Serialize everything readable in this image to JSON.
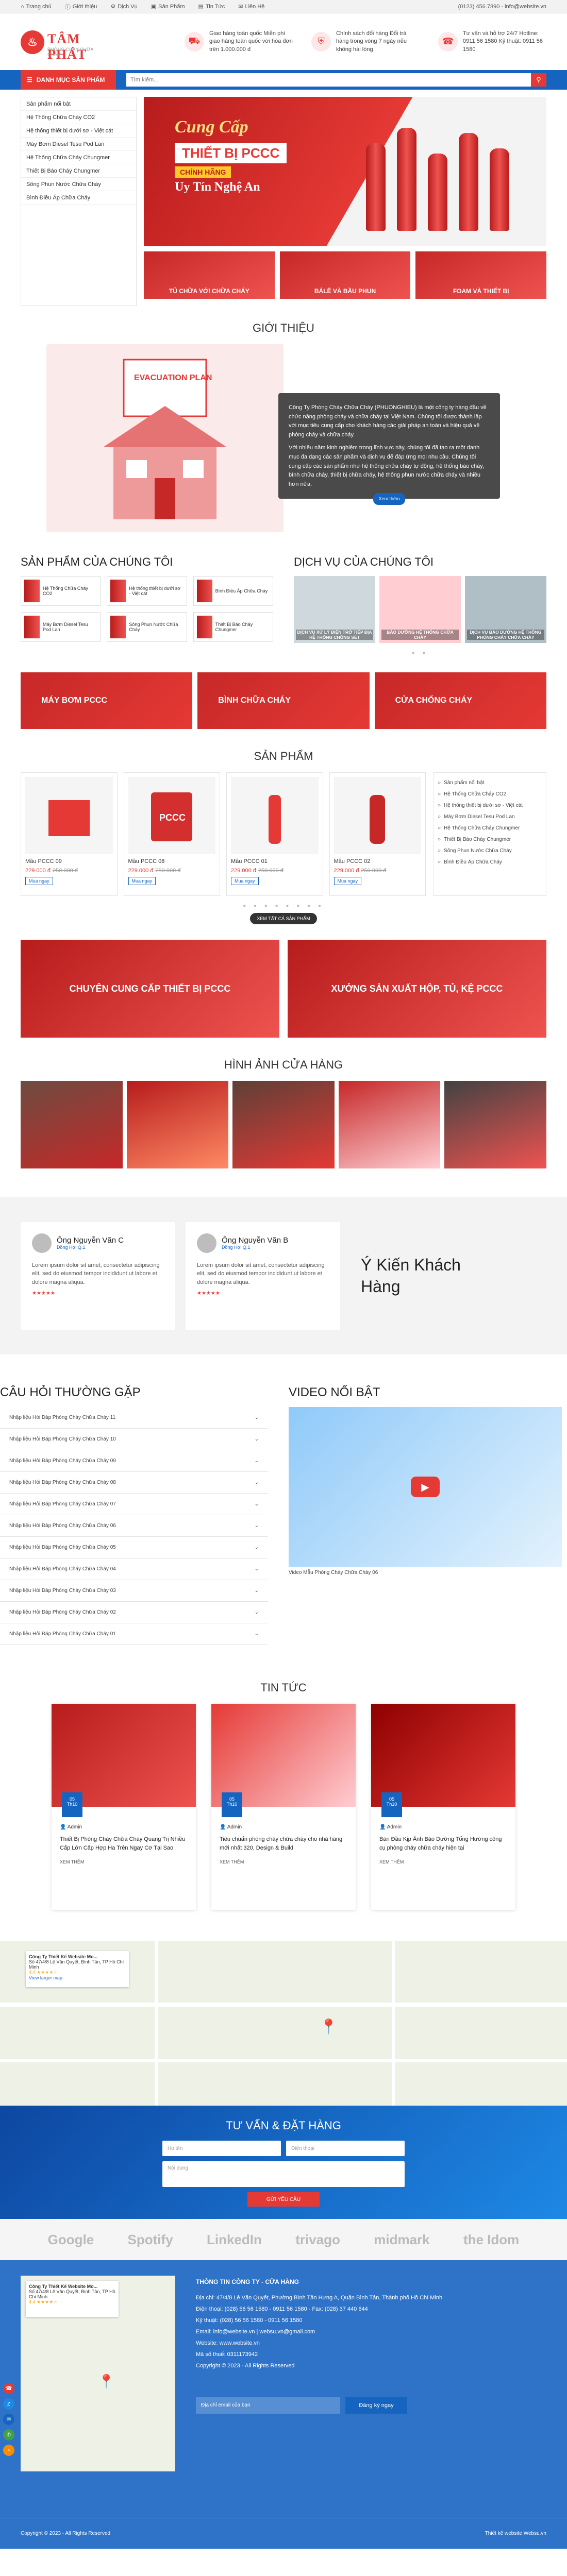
{
  "topbar": {
    "nav": [
      "Trang chủ",
      "Giới thiệu",
      "Dịch Vụ",
      "Sản Phẩm",
      "Tin Tức",
      "Liên Hệ"
    ],
    "contact": "(0123) 456.7890 - info@website.vn"
  },
  "header": {
    "logo_name": "TÂM PHÁT",
    "logo_tag": "PHÒNG CHÁY CHỮA CHÁY",
    "info": [
      {
        "icon": "truck-icon",
        "text": "Giao hàng toàn quốc Miễn phí giao hàng toàn quốc với hóa đơn trên 1.000.000 đ"
      },
      {
        "icon": "shield-icon",
        "text": "Chính sách đổi hàng Đổi trả hàng trong vòng 7 ngày nếu không hài lòng"
      },
      {
        "icon": "headset-icon",
        "text": "Tư vấn và hỗ trợ 24/7 Hotline: 0911 56 1580 Kỹ thuật: 0911 56 1580"
      }
    ]
  },
  "navbar": {
    "categories_label": "DANH MỤC SẢN PHẨM",
    "search_placeholder": "Tìm kiếm..."
  },
  "categories": [
    "Sản phẩm nổi bật",
    "Hệ Thống Chữa Cháy CO2",
    "Hệ thống thiết bị dưới sơ - Việt cát",
    "Máy Bơm Diesel Tesu Pod Lan",
    "Hệ Thống Chữa Cháy Chungmer",
    "Thiết Bị Báo Cháy Chungmer",
    "Sông Phun Nước Chữa Cháy",
    "Bình Điều Áp Chữa Cháy"
  ],
  "banner": {
    "t1": "Cung Cấp",
    "t2": "THIẾT BỊ PCCC",
    "t3": "CHÍNH HÃNG",
    "t4": "Uy Tín Nghệ An",
    "subs": [
      "TỦ CHỮA VỚI CHỮA CHÁY",
      "BÁLÊ VÀ BẦU PHUN",
      "FOAM VÀ THIẾT BỊ"
    ]
  },
  "intro": {
    "title": "GIỚI THIỆU",
    "poster": "EVACUATION PLAN",
    "p1": "Công Ty Phòng Cháy Chữa Cháy (PHUONGHIEU) là một công ty hàng đầu về chức năng phòng cháy và chữa cháy tại Việt Nam. Chúng tôi được thành lập với mục tiêu cung cấp cho khách hàng các giải pháp an toàn và hiệu quả về phòng cháy và chữa cháy.",
    "p2": "Với nhiều năm kinh nghiệm trong lĩnh vực này, chúng tôi đã tạo ra một danh mục đa dạng các sản phẩm và dịch vụ để đáp ứng mọi nhu cầu. Chúng tôi cung cấp các sản phẩm như hệ thống chữa cháy tự động, hệ thống báo cháy, bình chữa cháy, thiết bị chữa cháy, hệ thống phun nước chữa cháy và nhiều hơn nữa.",
    "btn": "Xem thêm"
  },
  "products_head": "SẢN PHẨM CỦA CHÚNG TÔI",
  "product_items": [
    "Hệ Thống Chữa Cháy CO2",
    "Hệ thống thiết bị dưới sơ - Việt cát",
    "Bình Điều Áp Chữa Cháy",
    "Máy Bơm Diesel Tesu Pod Lan",
    "Sông Phun Nước Chữa Cháy",
    "Thiết Bị Báo Cháy Chungmer"
  ],
  "services_head": "DỊCH VỤ CỦA CHÚNG TÔI",
  "services": [
    "DỊCH VỤ XỬ LÝ ĐIỆN TRỞ TIẾP ĐỊA HỆ THỐNG CHỐNG SÉT",
    "BẢO DƯỠNG HỆ THỐNG CHỮA CHÁY",
    "DỊCH VỤ BẢO DƯỠNG HỆ THỐNG PHÒNG CHÁY CHỮA CHÁY"
  ],
  "cat_banners": [
    "MÁY BƠM PCCC",
    "BÌNH CHỮA CHÁY",
    "CỬA CHỐNG CHÁY"
  ],
  "products_title": "SẢN PHẨM",
  "products": [
    {
      "name": "Mẫu PCCC 09",
      "price": "229.000 đ",
      "old": "250.000 đ",
      "btn": "Mua ngay"
    },
    {
      "name": "Mẫu PCCC 08",
      "price": "229.000 đ",
      "old": "250.000 đ",
      "btn": "Mua ngay"
    },
    {
      "name": "Mẫu PCCC 01",
      "price": "229.000 đ",
      "old": "250.000 đ",
      "btn": "Mua ngay"
    },
    {
      "name": "Mẫu PCCC 02",
      "price": "229.000 đ",
      "old": "250.000 đ",
      "btn": "Mua ngay"
    }
  ],
  "view_all": "XEM TẤT CẢ SẢN PHẨM",
  "banners2": [
    "CHUYÊN CUNG CẤP THIẾT BỊ PCCC",
    "XƯỞNG SẢN XUẤT HỘP, TỦ, KỆ PCCC"
  ],
  "gallery_title": "HÌNH ẢNH CỬA HÀNG",
  "testimonials": [
    {
      "name": "Ông Nguyễn Văn C",
      "role": "Đồng Hợi Q.1",
      "text": "Lorem ipsum dolor sit amet, consectetur adipiscing elit, sed do eiusmod tempor incididunt ut labore et dolore magna aliqua.",
      "stars": "★★★★★"
    },
    {
      "name": "Ông Nguyễn Văn B",
      "role": "Đồng Hợi Q.1",
      "text": "Lorem ipsum dolor sit amet, consectetur adipiscing elit, sed do eiusmod tempor incididunt ut labore et dolore magna aliqua.",
      "stars": "★★★★★"
    }
  ],
  "testi_title": "Ý Kiến Khách Hàng",
  "faq_title": "CÂU HỎI THƯỜNG GẶP",
  "faq": [
    "Nhập liệu Hỏi Đáp Phòng Cháy Chữa Cháy 11",
    "Nhập liệu Hỏi Đáp Phòng Cháy Chữa Cháy 10",
    "Nhập liệu Hỏi Đáp Phòng Cháy Chữa Cháy 09",
    "Nhập liệu Hỏi Đáp Phòng Cháy Chữa Cháy 08",
    "Nhập liệu Hỏi Đáp Phòng Cháy Chữa Cháy 07",
    "Nhập liệu Hỏi Đáp Phòng Cháy Chữa Cháy 06",
    "Nhập liệu Hỏi Đáp Phòng Cháy Chữa Cháy 05",
    "Nhập liệu Hỏi Đáp Phòng Cháy Chữa Cháy 04",
    "Nhập liệu Hỏi Đáp Phòng Cháy Chữa Cháy 03",
    "Nhập liệu Hỏi Đáp Phòng Cháy Chữa Cháy 02",
    "Nhập liệu Hỏi Đáp Phòng Cháy Chữa Cháy 01"
  ],
  "video_title": "VIDEO NỔI BẬT",
  "video_caption": "Video Mẫu Phòng Cháy Chữa Cháy 06",
  "news_title": "TIN TỨC",
  "news": [
    {
      "day": "05",
      "month": "Th10",
      "author": "Admin",
      "title": "Thiết Bị Phòng Cháy Chữa Cháy Quang Trị Nhiều Cấp Lớn Cấp Hợp Ha Trên Ngay Cơ Tại Sao",
      "more": "XEM THÊM"
    },
    {
      "day": "05",
      "month": "Th10",
      "author": "Admin",
      "title": "Tiêu chuẩn phòng cháy chữa cháy cho nhà hàng mới nhất 320, Design & Build",
      "more": "XEM THÊM"
    },
    {
      "day": "05",
      "month": "Th10",
      "author": "Admin",
      "title": "Bán Đầu Kịp Ảnh Bảo Dưỡng Tổng Hướng công cụ phòng cháy chữa cháy hiện tại",
      "more": "XEM THÊM"
    }
  ],
  "map_card": {
    "title": "Công Ty Thiết Kế Website Mo...",
    "addr": "Số 47/4/8 Lê Văn Quyết, Bình Tân, TP Hồ Chí Minh",
    "rating": "4.4 ★★★★☆",
    "link": "View larger map"
  },
  "form": {
    "title": "TƯ VẤN & ĐẶT HÀNG",
    "name": "Họ tên",
    "phone": "Điện thoại",
    "message": "Nội dung",
    "submit": "GỬI YÊU CẦU"
  },
  "partners": [
    "Google",
    "Spotify",
    "LinkedIn",
    "trivago",
    "midmark",
    "the Idom"
  ],
  "footer": {
    "heading": "THÔNG TIN CÔNG TY - CỬA HÀNG",
    "lines": [
      "Địa chỉ: 47/4/8 Lê Văn Quyết, Phường Bình Tân Hưng A, Quận Bình Tân, Thành phố Hồ Chí Minh",
      "Điện thoại: (028) 56 56 1580 - 0911 56 1580 - Fax: (028) 37 440 644",
      "Kỹ thuật: (028) 56 56 1580 - 0911 56 1580",
      "Email: info@website.vn | websu.vn@gmail.com",
      "Website: www.website.vn",
      "Mã số thuế: 0311173942",
      "Copyright © 2023 - All Rights Reserved"
    ],
    "subscribe_placeholder": "Địa chỉ email của bạn",
    "subscribe_btn": "Đăng ký ngay"
  },
  "copyright": {
    "left": "Copyright © 2023 - All Rights Reserved",
    "right": "Thiết kế website Websu.vn"
  },
  "floats": [
    "phone-icon",
    "zalo-icon",
    "messenger-icon",
    "sms-icon",
    "map-icon"
  ]
}
